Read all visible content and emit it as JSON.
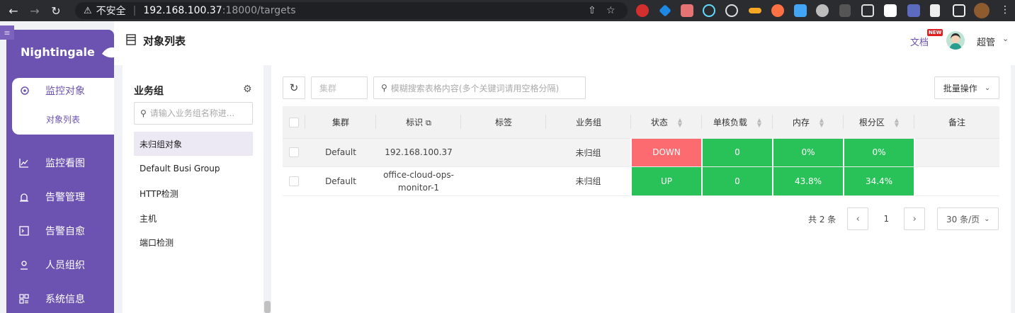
{
  "browser": {
    "insecure_label": "不安全",
    "url_host": "192.168.100.37",
    "url_path": ":18000/targets"
  },
  "sidebar": {
    "logo": "Nightingale",
    "active_item": "监控对象",
    "active_sub": "对象列表",
    "items": [
      {
        "label": "监控看图",
        "icon": "chart-icon"
      },
      {
        "label": "告警管理",
        "icon": "alarm-icon"
      },
      {
        "label": "告警自愈",
        "icon": "terminal-icon"
      },
      {
        "label": "人员组织",
        "icon": "user-icon"
      },
      {
        "label": "系统信息",
        "icon": "grid-icon"
      }
    ]
  },
  "header": {
    "page_title": "对象列表",
    "doc_link": "文档",
    "new_badge": "NEW",
    "username": "超管"
  },
  "group_panel": {
    "title": "业务组",
    "search_placeholder": "请输入业务组名称进...",
    "items": [
      "未归组对象",
      "Default Busi Group",
      "HTTP检测",
      "主机",
      "端口检测"
    ]
  },
  "toolbar": {
    "cluster_placeholder": "集群",
    "search_placeholder": "模糊搜索表格内容(多个关键词请用空格分隔)",
    "batch_label": "批量操作"
  },
  "table": {
    "columns": [
      "集群",
      "标识",
      "标签",
      "业务组",
      "状态",
      "单核负载",
      "内存",
      "根分区",
      "备注"
    ],
    "rows": [
      {
        "cluster": "Default",
        "ident": "192.168.100.37",
        "tags": "",
        "group": "未归组",
        "status": "DOWN",
        "load": "0",
        "mem": "0%",
        "disk": "0%",
        "note": ""
      },
      {
        "cluster": "Default",
        "ident": "office-cloud-ops-monitor-1",
        "tags": "",
        "group": "未归组",
        "status": "UP",
        "load": "0",
        "mem": "43.8%",
        "disk": "34.4%",
        "note": ""
      }
    ]
  },
  "pagination": {
    "total": "共 2 条",
    "page": "1",
    "page_size": "30 条/页"
  },
  "colors": {
    "brand": "#6c53b1",
    "status_up": "#29c258",
    "status_down": "#fc6b6f"
  }
}
